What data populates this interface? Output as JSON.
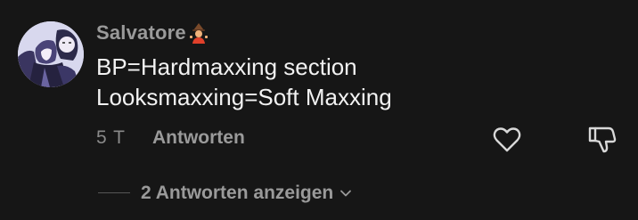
{
  "comment": {
    "author": "Salvatore",
    "author_emoji_icon": "mage-emoji-icon",
    "body_lines": [
      "BP=Hardmaxxing section",
      "Looksmaxxing=Soft Maxxing"
    ],
    "timestamp": "5 T",
    "reply_label": "Antworten",
    "like_icon": "heart-icon",
    "dislike_icon": "thumbs-down-icon",
    "show_replies_label": "2 Antworten anzeigen",
    "show_replies_icon": "chevron-down-icon"
  },
  "colors": {
    "background": "#161616",
    "text_primary": "#f2f2f2",
    "text_secondary": "#9a9a9a"
  }
}
